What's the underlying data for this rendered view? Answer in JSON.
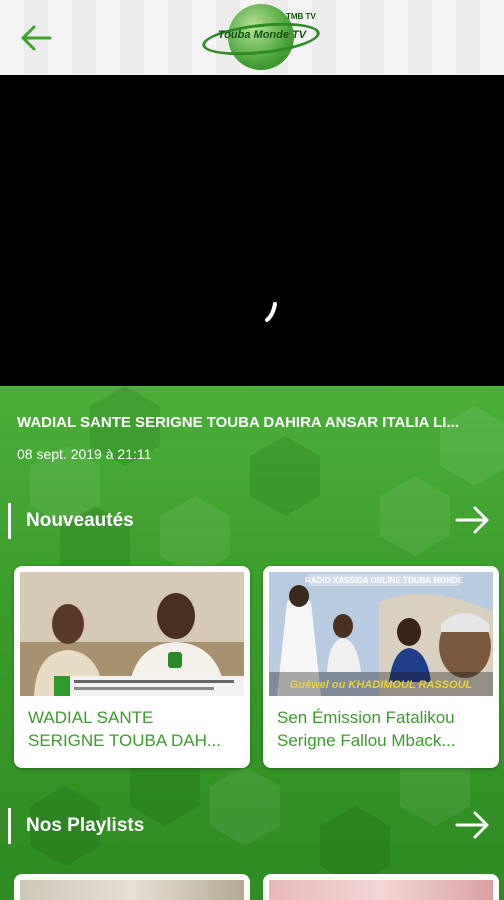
{
  "header": {
    "back_icon": "arrow-left-icon",
    "logo_text": "Touba Monde TV",
    "logo_sub": "TMB TV"
  },
  "player": {
    "state": "loading"
  },
  "current_video": {
    "title": "WADIAL SANTE SERIGNE TOUBA DAHIRA ANSAR ITALIA LI...",
    "date": "08 sept. 2019 à 21:11"
  },
  "sections": [
    {
      "title": "Nouveautés",
      "arrow_icon": "arrow-right-icon",
      "cards": [
        {
          "title_line1": "WADIAL SANTE",
          "title_line2": "SERIGNE TOUBA DAH..."
        },
        {
          "title_line1": "Sen Émission  Fatalikou",
          "title_line2": "Serigne Fallou Mback..."
        }
      ]
    },
    {
      "title": "Nos Playlists",
      "arrow_icon": "arrow-right-icon"
    }
  ],
  "thumbs": {
    "card2_banner": "RADIO XASSIDA ONLINE TOUBA MONDE",
    "card2_caption": "Guéwel ou KHADIMOUL RASSOUL"
  },
  "colors": {
    "accent": "#3e9a2e",
    "background": "#3a9a2c",
    "topbar": "#f2f2f2"
  }
}
